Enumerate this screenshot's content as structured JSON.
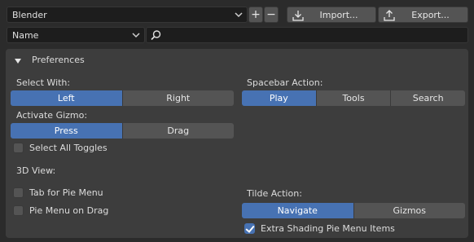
{
  "preset": {
    "selected": "Blender",
    "add_label": "+",
    "remove_label": "−",
    "import_label": "Import...",
    "export_label": "Export..."
  },
  "filter": {
    "selected": "Name",
    "search_value": ""
  },
  "panel": {
    "title": "Preferences",
    "select_with": {
      "label": "Select With:",
      "options": [
        "Left",
        "Right"
      ],
      "active": "Left"
    },
    "spacebar_action": {
      "label": "Spacebar Action:",
      "options": [
        "Play",
        "Tools",
        "Search"
      ],
      "active": "Play"
    },
    "activate_gizmo": {
      "label": "Activate Gizmo:",
      "options": [
        "Press",
        "Drag"
      ],
      "active": "Press"
    },
    "select_all_toggles": {
      "label": "Select All Toggles",
      "checked": false
    },
    "view3d": {
      "label": "3D View:",
      "tab_for_pie_menu": {
        "label": "Tab for Pie Menu",
        "checked": false
      },
      "pie_menu_on_drag": {
        "label": "Pie Menu on Drag",
        "checked": false
      }
    },
    "tilde_action": {
      "label": "Tilde Action:",
      "options": [
        "Navigate",
        "Gizmos"
      ],
      "active": "Navigate"
    },
    "extra_shading": {
      "label": "Extra Shading Pie Menu Items",
      "checked": true
    }
  },
  "colors": {
    "accent": "#4772b3",
    "background": "#2b2b2b",
    "panel": "#3d3d3d",
    "button": "#545454"
  }
}
